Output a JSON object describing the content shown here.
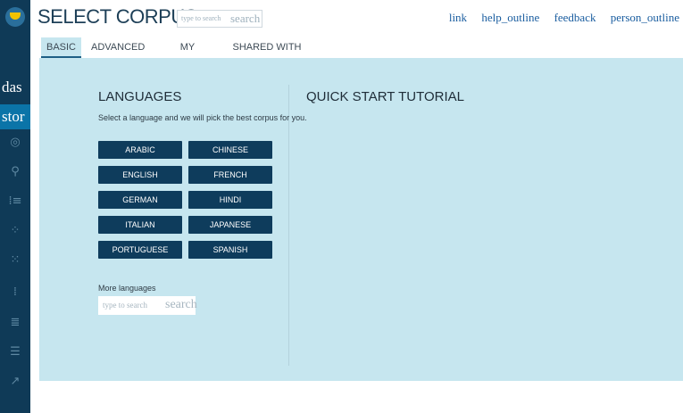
{
  "header": {
    "title": "SELECT CORPUS",
    "search": {
      "placeholder": "type to search",
      "button": "search"
    },
    "links": [
      "link",
      "help_outline",
      "feedback",
      "person_outline"
    ]
  },
  "sidebar": {
    "text_items": [
      {
        "label": "das",
        "active": false
      },
      {
        "label": "stor",
        "active": true
      }
    ],
    "icons": [
      "target-icon",
      "location-icon",
      "list-dots-icon",
      "grid-dots-icon",
      "network-icon",
      "list-bars-icon",
      "ne-list-icon",
      "numbered-list-icon",
      "trend-icon"
    ]
  },
  "tabs": [
    {
      "label": "BASIC",
      "active": true
    },
    {
      "label": "ADVANCED",
      "active": false
    },
    {
      "label": "MY CORPORA",
      "active": false
    },
    {
      "label": "SHARED WITH ME",
      "active": false
    }
  ],
  "languages": {
    "heading": "LANGUAGES",
    "subtext": "Select a language and we will pick the best corpus for you.",
    "buttons": [
      "ARABIC",
      "CHINESE",
      "ENGLISH",
      "FRENCH",
      "GERMAN",
      "HINDI",
      "ITALIAN",
      "JAPANESE",
      "PORTUGUESE",
      "SPANISH"
    ],
    "more_label": "More languages",
    "more_search": {
      "placeholder": "type to search",
      "button": "search"
    }
  },
  "tutorial": {
    "heading": "QUICK START TUTORIAL"
  },
  "colors": {
    "sidebar": "#0f3a57",
    "panel": "#c6e6ef",
    "button": "#0e3c5c",
    "accent": "#0b74a8",
    "link": "#1b5ea0"
  }
}
